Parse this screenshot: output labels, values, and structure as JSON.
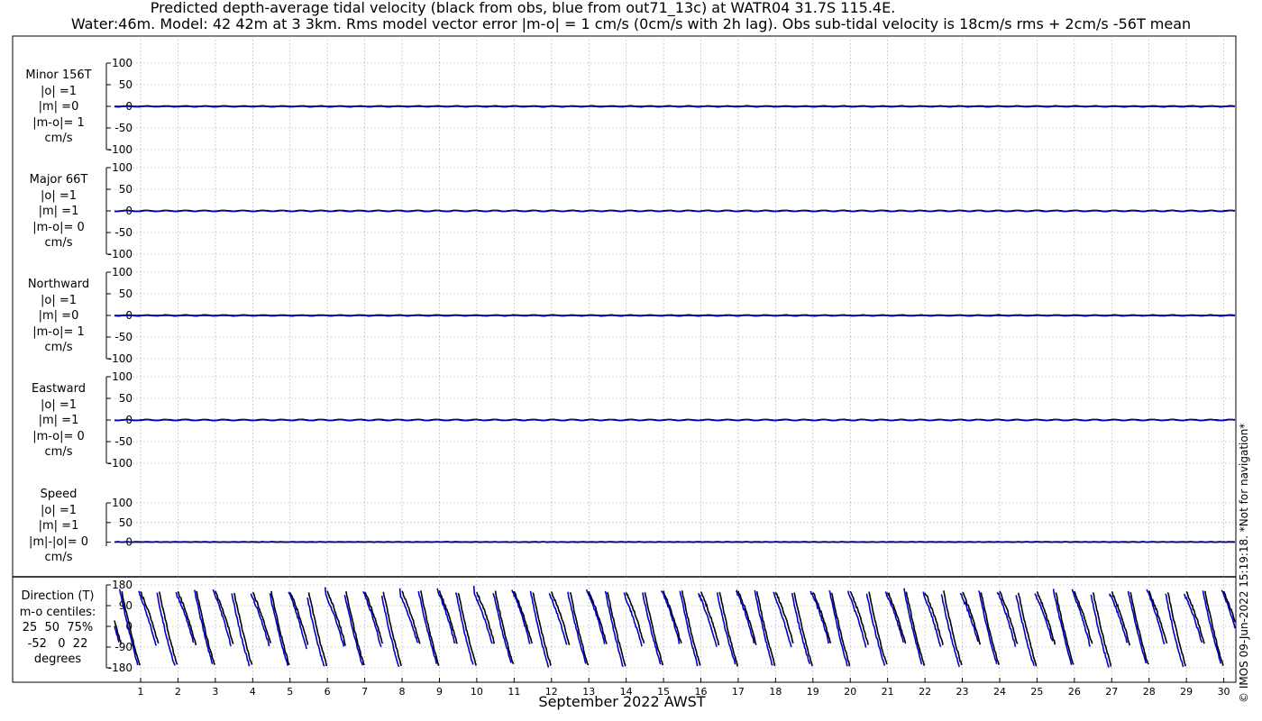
{
  "title_line1": "Predicted depth-average tidal velocity (black from obs, blue from out71_13c) at WATR04 31.7S 115.4E.",
  "title_line2": "Water:46m. Model: 42 42m at 3 3km. Rms model vector error |m-o| = 1 cm/s (0cm/s with 2h lag). Obs sub-tidal velocity is 18cm/s rms + 2cm/s -56T mean",
  "credit": "© IMOS 09-Jun-2022 15:19:18. *Not for navigation*",
  "colors": {
    "obs": "#000000",
    "model": "#0000cc",
    "grid": "#9a9aa8"
  },
  "chart_data": {
    "type": "line",
    "xlabel": "September 2022 AWST",
    "xticks": [
      "1",
      "2",
      "3",
      "4",
      "5",
      "6",
      "7",
      "8",
      "9",
      "10",
      "11",
      "12",
      "13",
      "14",
      "15",
      "16",
      "17",
      "18",
      "19",
      "20",
      "21",
      "22",
      "23",
      "24",
      "25",
      "26",
      "27",
      "28",
      "29",
      "30"
    ],
    "xlim": [
      0.3,
      30.3
    ],
    "panels": [
      {
        "id": "minor",
        "label_lines": [
          "Minor 156T",
          "|o| =1",
          "|m| =0",
          "|m-o|= 1",
          "cm/s"
        ],
        "ylim": [
          -100,
          100
        ],
        "yticks": [
          "100",
          "50",
          "0",
          "-50",
          "-100"
        ],
        "obs_amp": 1,
        "model_amp": 0
      },
      {
        "id": "major",
        "label_lines": [
          "Major 66T",
          "|o| =1",
          "|m| =1",
          "|m-o|= 0",
          "cm/s"
        ],
        "ylim": [
          -100,
          100
        ],
        "yticks": [
          "100",
          "50",
          "0",
          "-50",
          "-100"
        ],
        "obs_amp": 1,
        "model_amp": 1
      },
      {
        "id": "north",
        "label_lines": [
          "Northward",
          "|o| =1",
          "|m| =0",
          "|m-o|= 1",
          "cm/s"
        ],
        "ylim": [
          -100,
          100
        ],
        "yticks": [
          "100",
          "50",
          "0",
          "-50",
          "-100"
        ],
        "obs_amp": 1,
        "model_amp": 0
      },
      {
        "id": "east",
        "label_lines": [
          "Eastward",
          "|o| =1",
          "|m| =1",
          "|m-o|= 0",
          "cm/s"
        ],
        "ylim": [
          -100,
          100
        ],
        "yticks": [
          "100",
          "50",
          "0",
          "-50",
          "-100"
        ],
        "obs_amp": 1,
        "model_amp": 1
      },
      {
        "id": "speed",
        "label_lines": [
          "Speed",
          "|o| =1",
          "|m| =1",
          "|m|-|o|= 0",
          "cm/s"
        ],
        "ylim": [
          -10,
          100
        ],
        "yticks": [
          "100",
          "50",
          "0"
        ],
        "obs_amp": 1,
        "model_amp": 1
      },
      {
        "id": "direction",
        "label_lines": [
          "Direction (T)",
          "m-o centiles:",
          "25  50  75%",
          "-52   0  22",
          "degrees"
        ],
        "ylim": [
          -180,
          180
        ],
        "yticks": [
          "180",
          "90",
          "0",
          "-90",
          "-180"
        ],
        "dir_range": [
          -180,
          180
        ]
      }
    ]
  }
}
